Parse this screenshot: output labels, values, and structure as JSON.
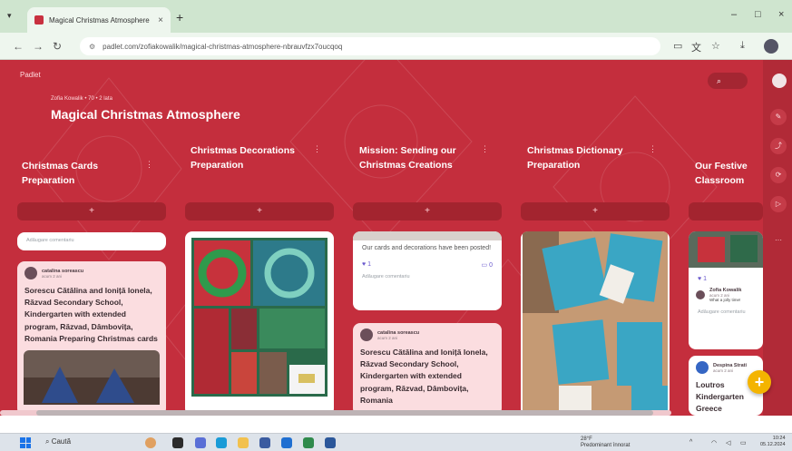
{
  "browser": {
    "tab_title": "Magical Christmas Atmosphere",
    "tab_close": "×",
    "new_tab": "+",
    "url": "padlet.com/zofiakowalik/magical-christmas-atmosphere-nbrauvfzx7oucqoq",
    "window": {
      "minimize": "–",
      "maximize": "□",
      "close": "×"
    }
  },
  "padlet": {
    "brand": "Padlet",
    "meta": "Zofia Kowalik • 70 • 2 lata",
    "title": "Magical Christmas Atmosphere",
    "search_icon": "⌕",
    "add_label": "+",
    "fab_label": "+",
    "columns": [
      {
        "title": "Christmas Cards Preparation",
        "more": "⋮"
      },
      {
        "title": "Christmas Decorations Preparation",
        "more": "⋮"
      },
      {
        "title": "Mission: Sending our Christmas Creations",
        "more": "⋮"
      },
      {
        "title": "Christmas Dictionary Preparation",
        "more": "⋮"
      },
      {
        "title": "Our Festive Classroom",
        "more": ""
      }
    ],
    "col1": {
      "comment_placeholder": "Adăugare comentariu",
      "post": {
        "author": "catalina soreascu",
        "time": "acum 2 ani",
        "text": "Sorescu Cătălina and Ioniță Ionela, Răzvad Secondary School, Kindergarten with extended program, Răzvad, Dâmbovița, Romania Preparing Christmas cards"
      }
    },
    "col3": {
      "card_text": "Our cards and decorations have been posted!",
      "like_count": "1",
      "comment_count": "0",
      "comment_placeholder": "Adăugare comentariu",
      "post": {
        "author": "catalina soreascu",
        "time": "acum 2 ani",
        "text": "Sorescu Cătălina and Ioniță Ionela, Răzvad Secondary School, Kindergarten with extended program, Răzvad, Dâmbovița, Romania"
      }
    },
    "col5": {
      "like_count": "1",
      "comment": {
        "author": "Zofia Kowalik",
        "time": "acum 2 ani",
        "text": "What a jolly time!"
      },
      "comment_placeholder": "Adăugare comentariu",
      "post": {
        "author": "Despina Strati",
        "time": "acum 2 ani",
        "text": "Loutros Kindergarten Greece"
      }
    }
  },
  "taskbar": {
    "search": "Caută",
    "weather_temp": "28°F",
    "weather_text": "Predominant înnorat",
    "time": "10:24",
    "date": "05.12.2024"
  }
}
